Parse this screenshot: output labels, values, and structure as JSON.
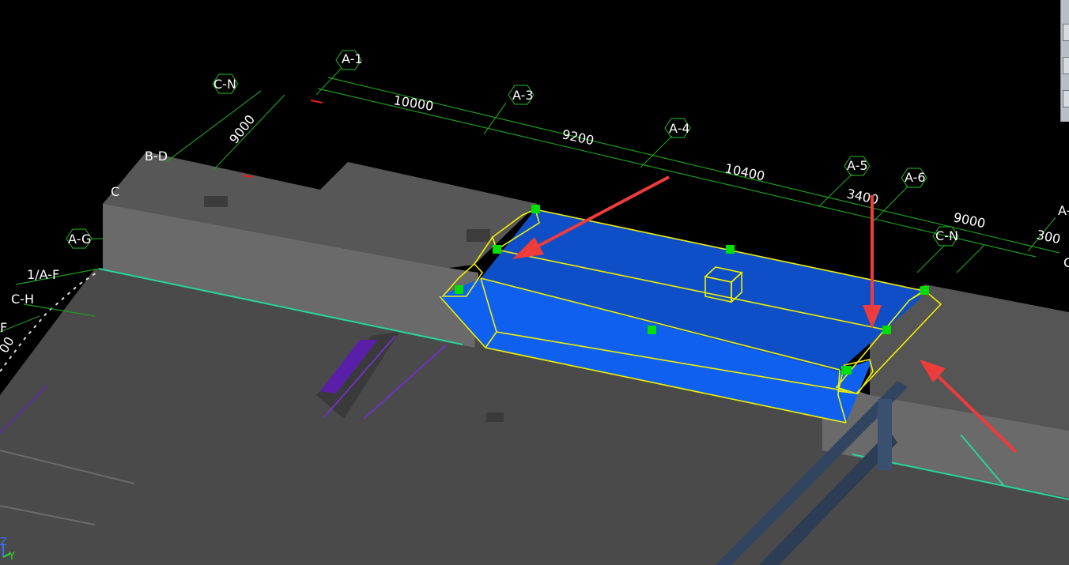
{
  "grid_axes": {
    "a1": "A-1",
    "a3": "A-3",
    "a4": "A-4",
    "a5": "A-5",
    "a6": "A-6",
    "a7_partial": "A-",
    "cn_left": "C-N",
    "cn_right": "C-N",
    "bd": "B-D",
    "ag": "A-G",
    "one_af": "1/A-F",
    "ch": "C-H",
    "f_partial": "F",
    "c_partial_left": "C",
    "c_partial_right": "C"
  },
  "dimensions": {
    "d_a1_a3": "10000",
    "d_a3_a4": "9200",
    "d_a4_a5": "10400",
    "d_a5_a6": "3400",
    "d_a6_a7": "9000",
    "d_end": "300",
    "d_vertical": "9000",
    "d_left_partial": "00"
  },
  "axis_gizmo": {
    "z": "Z",
    "y": "Y"
  },
  "colors": {
    "background": "#000000",
    "axis_line": "#1f9a1f",
    "selection_outline": "#f0f000",
    "selected_fill": "#1060f0",
    "grip": "#00e000",
    "arrow": "#ee3b3b",
    "slab": "#4b4b4b",
    "wall_face": "#636363",
    "cyan_edge": "#27d59a",
    "purple_trench": "#5a1fa8"
  },
  "toolbar": {
    "icons": [
      "view-cube-icon",
      "orbit-icon",
      "layer-icon"
    ]
  }
}
